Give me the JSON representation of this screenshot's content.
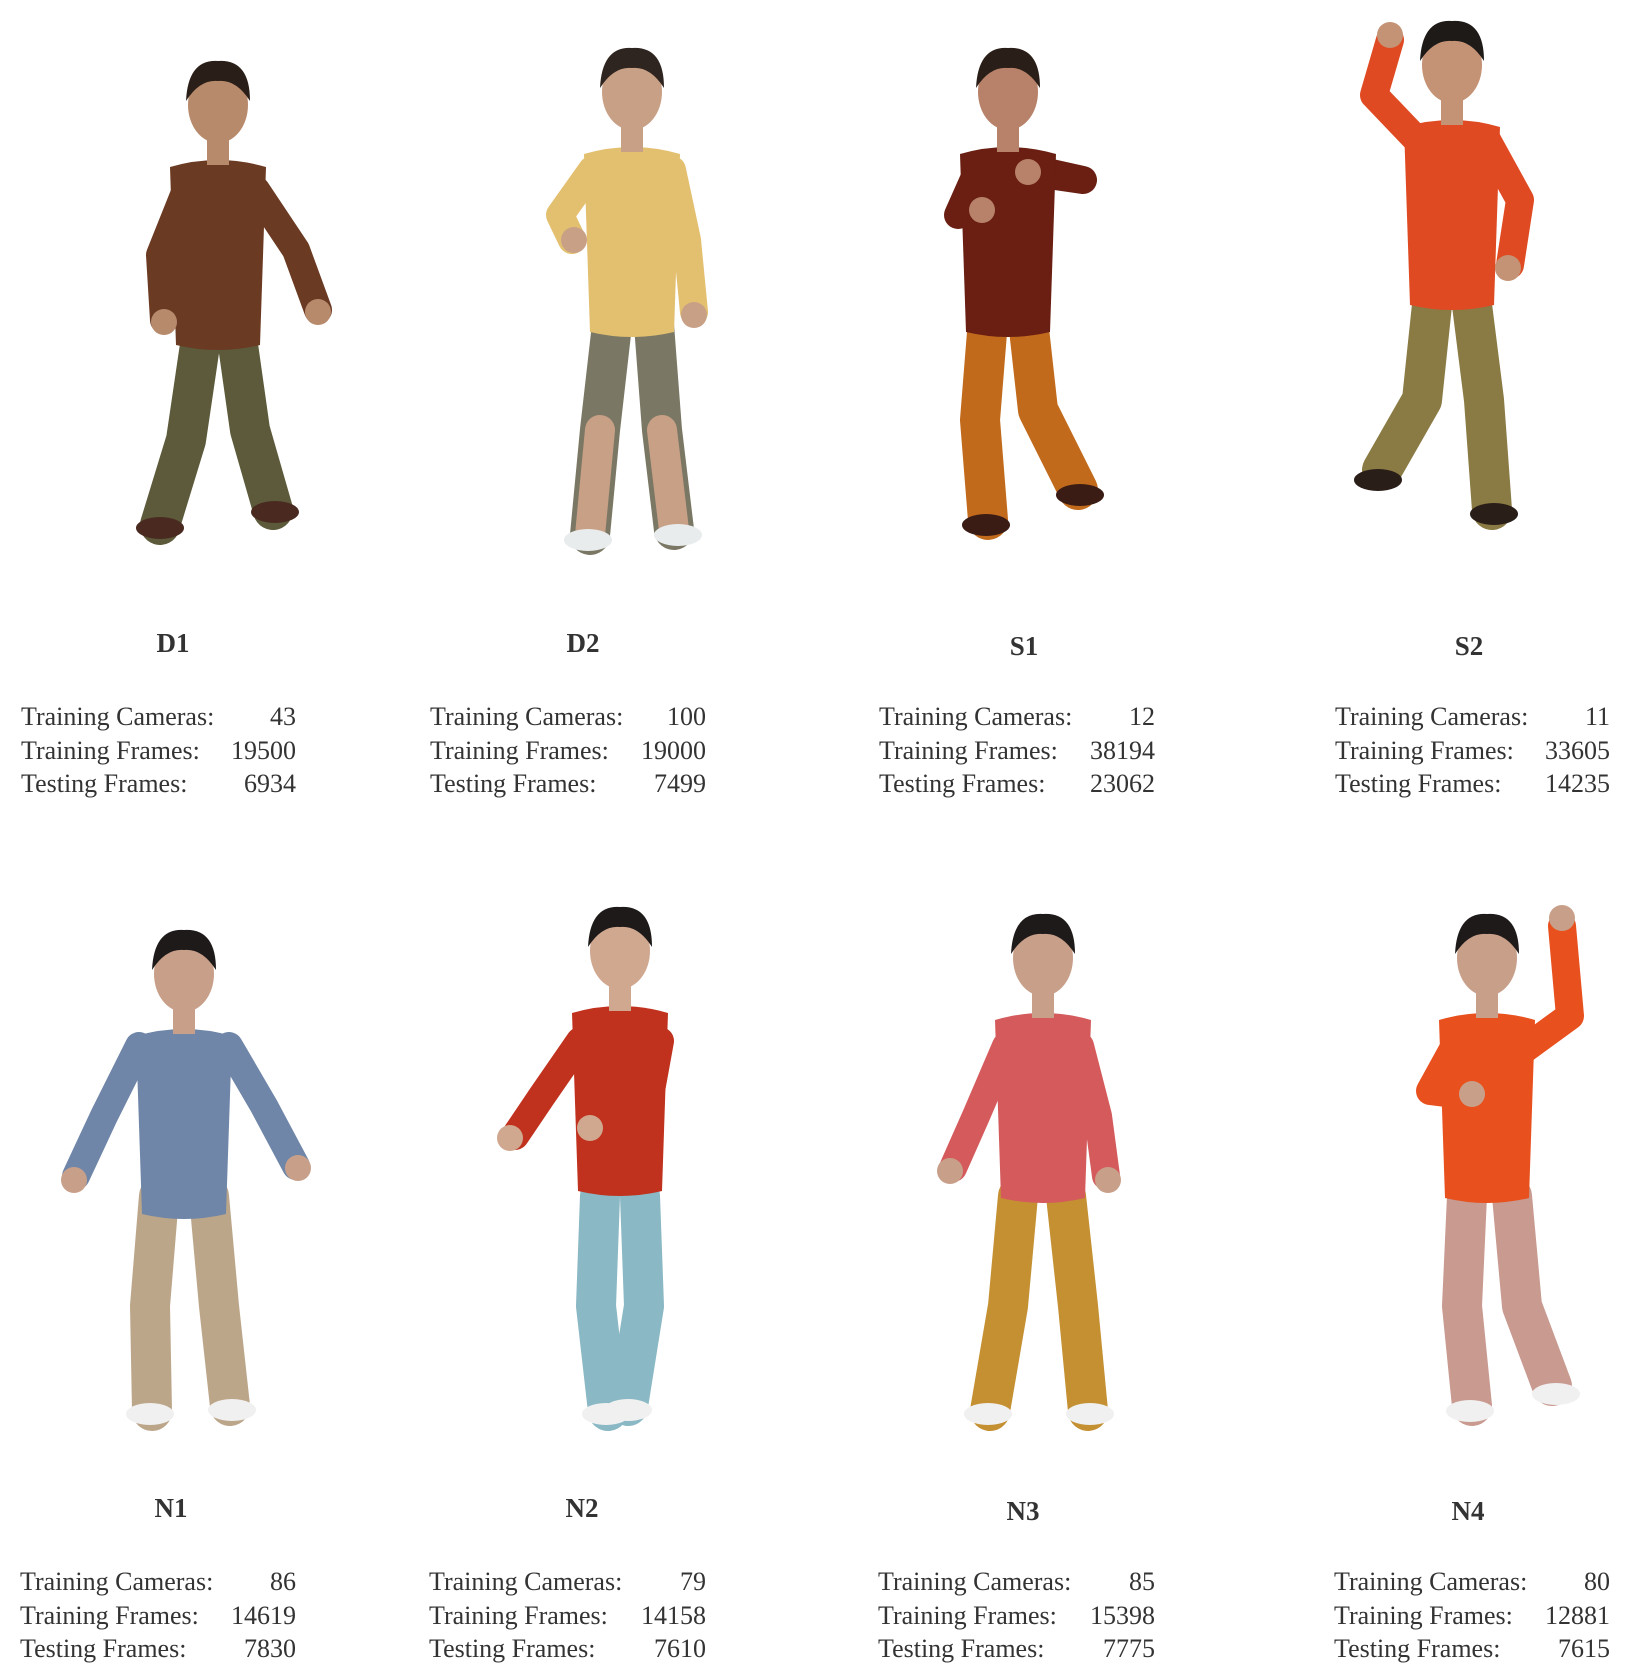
{
  "subjects": [
    {
      "name": "D1",
      "training_cameras_label": "Training Cameras:",
      "training_cameras": "43",
      "training_frames_label": "Training Frames:",
      "training_frames": "19500",
      "testing_frames_label": "Testing Frames:",
      "testing_frames": "6934",
      "colors": {
        "skin": "#b88a6c",
        "hair": "#2a1f18",
        "top": "#6b3a22",
        "bottom": "#5c5a3a",
        "shoes": "#4a2a20"
      },
      "pose": "walk"
    },
    {
      "name": "D2",
      "training_cameras_label": "Training Cameras:",
      "training_cameras": "100",
      "training_frames_label": "Training Frames:",
      "training_frames": "19000",
      "testing_frames_label": "Testing Frames:",
      "testing_frames": "7499",
      "colors": {
        "skin": "#c8a086",
        "hair": "#2f2520",
        "top": "#e3c070",
        "bottom": "#7a7864",
        "shoes": "#e8ecec"
      },
      "pose": "stand-shorts"
    },
    {
      "name": "S1",
      "training_cameras_label": "Training Cameras:",
      "training_cameras": "12",
      "training_frames_label": "Training Frames:",
      "training_frames": "38194",
      "testing_frames_label": "Testing Frames:",
      "testing_frames": "23062",
      "colors": {
        "skin": "#b8826a",
        "hair": "#2a1e18",
        "top": "#6a1f12",
        "bottom": "#c26a1c",
        "shoes": "#3a1c14"
      },
      "pose": "box"
    },
    {
      "name": "S2",
      "training_cameras_label": "Training Cameras:",
      "training_cameras": "11",
      "training_frames_label": "Training Frames:",
      "training_frames": "33605",
      "testing_frames_label": "Testing Frames:",
      "testing_frames": "14235",
      "colors": {
        "skin": "#c49274",
        "hair": "#1e1a18",
        "top": "#e04a22",
        "bottom": "#8a7a44",
        "shoes": "#2a1e18"
      },
      "pose": "raise-left"
    },
    {
      "name": "N1",
      "training_cameras_label": "Training Cameras:",
      "training_cameras": "86",
      "training_frames_label": "Training Frames:",
      "training_frames": "14619",
      "testing_frames_label": "Testing Frames:",
      "testing_frames": "7830",
      "colors": {
        "skin": "#c8a08a",
        "hair": "#1e1a1a",
        "top": "#6f86a8",
        "bottom": "#bca68a",
        "shoes": "#f0f0f0"
      },
      "pose": "stand-arms-out"
    },
    {
      "name": "N2",
      "training_cameras_label": "Training Cameras:",
      "training_cameras": "79",
      "training_frames_label": "Training Frames:",
      "training_frames": "14158",
      "testing_frames_label": "Testing Frames:",
      "testing_frames": "7610",
      "colors": {
        "skin": "#d0a890",
        "hair": "#1e1a1a",
        "top": "#c0321e",
        "bottom": "#8ab8c4",
        "shoes": "#f0f0f0"
      },
      "pose": "reach-left"
    },
    {
      "name": "N3",
      "training_cameras_label": "Training Cameras:",
      "training_cameras": "85",
      "training_frames_label": "Training Frames:",
      "training_frames": "15398",
      "testing_frames_label": "Testing Frames:",
      "testing_frames": "7775",
      "colors": {
        "skin": "#c8a08a",
        "hair": "#1e1a1a",
        "top": "#d45a5c",
        "bottom": "#c49032",
        "shoes": "#f0f0f0"
      },
      "pose": "stand-fists"
    },
    {
      "name": "N4",
      "training_cameras_label": "Training Cameras:",
      "training_cameras": "80",
      "training_frames_label": "Training Frames:",
      "training_frames": "12881",
      "testing_frames_label": "Testing Frames:",
      "testing_frames": "7615",
      "colors": {
        "skin": "#c8a08a",
        "hair": "#1e1a1a",
        "top": "#e8501e",
        "bottom": "#c89a90",
        "shoes": "#f0f0f0"
      },
      "pose": "raise-right"
    }
  ]
}
